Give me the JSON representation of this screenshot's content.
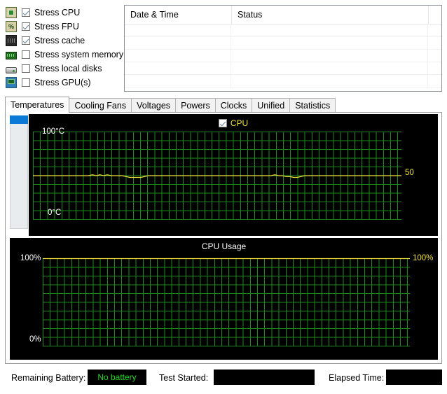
{
  "stress_options": {
    "items": [
      {
        "label": "Stress CPU",
        "checked": true,
        "icon": "cpu-chip-icon"
      },
      {
        "label": "Stress FPU",
        "checked": true,
        "icon": "fpu-percent-icon"
      },
      {
        "label": "Stress cache",
        "checked": true,
        "icon": "cache-chip-icon"
      },
      {
        "label": "Stress system memory",
        "checked": false,
        "icon": "memory-stick-icon"
      },
      {
        "label": "Stress local disks",
        "checked": false,
        "icon": "hard-disk-icon"
      },
      {
        "label": "Stress GPU(s)",
        "checked": false,
        "icon": "gpu-monitor-icon"
      }
    ]
  },
  "log_table": {
    "columns": [
      "Date & Time",
      "Status",
      ""
    ],
    "rows": []
  },
  "tabs": {
    "items": [
      {
        "label": "Temperatures",
        "active": true
      },
      {
        "label": "Cooling Fans",
        "active": false
      },
      {
        "label": "Voltages",
        "active": false
      },
      {
        "label": "Powers",
        "active": false
      },
      {
        "label": "Clocks",
        "active": false
      },
      {
        "label": "Unified",
        "active": false
      },
      {
        "label": "Statistics",
        "active": false
      }
    ]
  },
  "sensor_list": {
    "selected_index": 0,
    "items": [
      ""
    ]
  },
  "chart_data": [
    {
      "id": "temperature",
      "type": "line",
      "title": "",
      "legend": [
        {
          "label": "CPU",
          "checked": true,
          "color": "#f2e33a"
        }
      ],
      "legend_position": "top-center",
      "grid": true,
      "grid_color": "#1c8c1c",
      "background": "#000000",
      "ylabel": "",
      "xlabel": "",
      "ylim": [
        0,
        100
      ],
      "ytick_labels": [
        "100°C",
        "0°C"
      ],
      "right_label": "50",
      "right_label_color": "#f2e33a",
      "series": [
        {
          "name": "CPU",
          "color": "#f2e33a",
          "units": "°C",
          "values": [
            50,
            50,
            50,
            50,
            50,
            50,
            50,
            50,
            50,
            50,
            50,
            50,
            50,
            50,
            50,
            50,
            51,
            50,
            51,
            50,
            51,
            50,
            50,
            50,
            50,
            49,
            48,
            48,
            48,
            48,
            49,
            50,
            50,
            50,
            50,
            50,
            50,
            50,
            50,
            50,
            50,
            50,
            50,
            50,
            50,
            50,
            50,
            50,
            50,
            50,
            50,
            50,
            50,
            50,
            50,
            50,
            50,
            50,
            50,
            50,
            50,
            50,
            50,
            50,
            50,
            51,
            50,
            50,
            49,
            49,
            48,
            48,
            49,
            50,
            50,
            50,
            50,
            50,
            50,
            50,
            50,
            50,
            50,
            50,
            50,
            50,
            50,
            50,
            50,
            50,
            50,
            50,
            50,
            50,
            50,
            50,
            50,
            50,
            50,
            50
          ]
        }
      ]
    },
    {
      "id": "cpu_usage",
      "type": "line",
      "title": "CPU Usage",
      "legend": [],
      "grid": true,
      "grid_color": "#1c8c1c",
      "background": "#000000",
      "ylabel": "",
      "xlabel": "",
      "ylim": [
        0,
        100
      ],
      "ytick_labels": [
        "100%",
        "0%"
      ],
      "right_label": "100%",
      "right_label_color": "#f2e33a",
      "series": [
        {
          "name": "CPU Usage",
          "color": "#f2e33a",
          "units": "%",
          "values": [
            100,
            100,
            100,
            100,
            100,
            100,
            100,
            100,
            100,
            100,
            100,
            100,
            100,
            100,
            100,
            100,
            100,
            100,
            100,
            100,
            100,
            100,
            100,
            100,
            100,
            100,
            100,
            100,
            100,
            100,
            100,
            100,
            100,
            100,
            100,
            100,
            100,
            100,
            100,
            100,
            100,
            100,
            100,
            100,
            100,
            100,
            100,
            100,
            100,
            100,
            100,
            100,
            100,
            100,
            100,
            100,
            100,
            100,
            100,
            100,
            100,
            100,
            100,
            100,
            100,
            100,
            100,
            100,
            100,
            100,
            100,
            100,
            100,
            100,
            100,
            100,
            100,
            100,
            100,
            100,
            100,
            100,
            100,
            100,
            100,
            100,
            100,
            100,
            100,
            100,
            100,
            100,
            100,
            100,
            100,
            100,
            100,
            100,
            100,
            100
          ]
        }
      ]
    }
  ],
  "status_bar": {
    "battery_label": "Remaining Battery:",
    "battery_value": "No battery",
    "battery_value_color": "#1ddb1d",
    "test_started_label": "Test Started:",
    "test_started_value": "",
    "elapsed_label": "Elapsed Time:",
    "elapsed_value": ""
  }
}
